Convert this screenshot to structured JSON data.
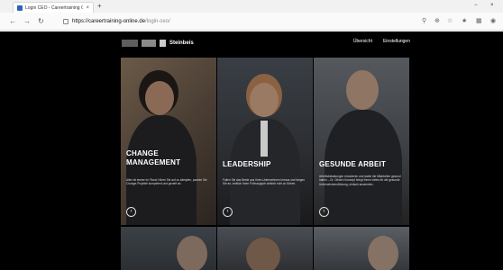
{
  "browser": {
    "tab_title": "Login CEO - Careertraining Onli",
    "tab_close": "×",
    "new_tab": "+",
    "url_host": "https://careertraining-online.de",
    "url_path": "/login-ceo/",
    "window_minimize": "−",
    "window_close": "×",
    "nav_back": "←",
    "nav_forward": "→",
    "nav_reload": "↻"
  },
  "site": {
    "brand": "Steinbeis",
    "nav": [
      "Übersicht",
      "Einstellungen"
    ]
  },
  "tiles": [
    {
      "title": [
        "CHANGE",
        "MANAGEMENT"
      ],
      "description": "Alles ist immer im Fluss! Hören Sie auf zu kämpfen, packen Sie Change-Projekte kompetent und gezielt an.",
      "arrow": "›"
    },
    {
      "title": [
        "LEADERSHIP"
      ],
      "description": "Fallen Sie das Beste aus Ihren Unternehmen heraus und fangen Sie an, wirklich ihren Führungsjob wirklich echt zu führen.",
      "arrow": "›"
    },
    {
      "title": [
        "GESUNDE ARBEIT"
      ],
      "description": "Arbeitsbelastungen reduzieren und dabei die Mitarbeiter gesund halten – Dr. Olivia's Konzept bringt Ihnen vieles für die gesunde Unternehmensführung, einfach anwenden.",
      "arrow": "›"
    }
  ]
}
